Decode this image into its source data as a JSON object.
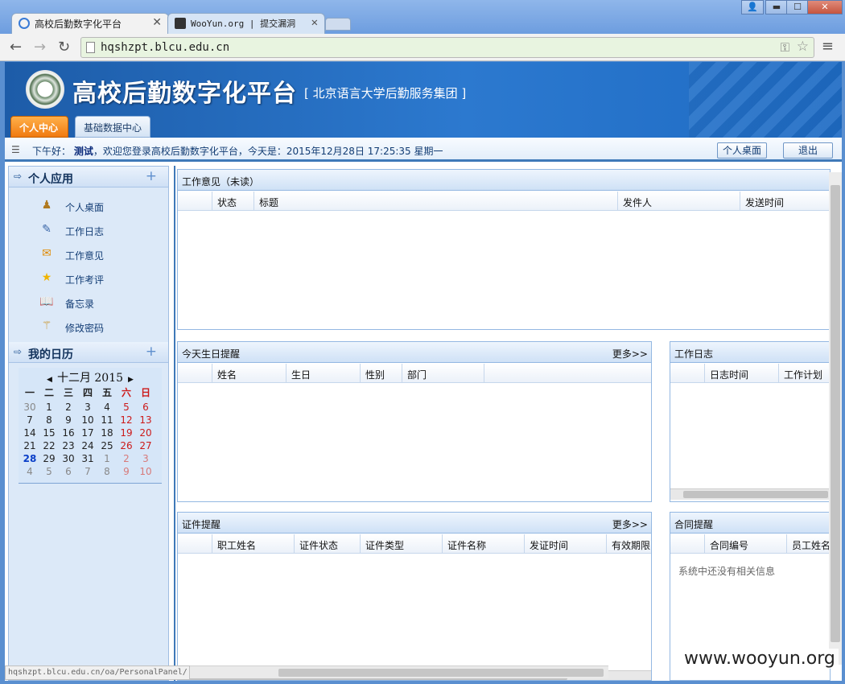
{
  "browser": {
    "tabs": [
      {
        "title": "高校后勤数字化平台",
        "close": "✕"
      },
      {
        "title": "WooYun.org | 提交漏洞",
        "close": "✕"
      }
    ],
    "url": "hqshzpt.blcu.edu.cn",
    "status_text": "hqshzpt.blcu.edu.cn/oa/PersonalPanel/",
    "window_buttons": {
      "user": "👤",
      "minimize": "▬",
      "maximize": "☐",
      "close": "✕"
    }
  },
  "header": {
    "title": "高校后勤数字化平台",
    "subtitle": "[ 北京语言大学后勤服务集团 ]",
    "tabs": {
      "personal": "个人中心",
      "basedata": "基础数据中心"
    }
  },
  "infobar": {
    "greeting_prefix": "下午好：",
    "user": "测试",
    "greeting_rest": "，欢迎您登录高校后勤数字化平台，今天是：2015年12月28日 17:25:35 星期一",
    "desktop_button": "个人桌面",
    "logout_button": "退出"
  },
  "sidebar": {
    "apps_title": "个人应用",
    "items": [
      {
        "label": "个人桌面",
        "icon": "person-icon"
      },
      {
        "label": "工作日志",
        "icon": "notepad-icon"
      },
      {
        "label": "工作意见",
        "icon": "envelope-icon"
      },
      {
        "label": "工作考评",
        "icon": "star-icon"
      },
      {
        "label": "备忘录",
        "icon": "book-icon"
      },
      {
        "label": "修改密码",
        "icon": "wand-icon"
      }
    ],
    "calendar_title": "我的日历",
    "calendar": {
      "month_label": "十二月 2015",
      "weekdays": [
        "一",
        "二",
        "三",
        "四",
        "五",
        "六",
        "日"
      ],
      "rows": [
        [
          "30",
          "1",
          "2",
          "3",
          "4",
          "5",
          "6"
        ],
        [
          "7",
          "8",
          "9",
          "10",
          "11",
          "12",
          "13"
        ],
        [
          "14",
          "15",
          "16",
          "17",
          "18",
          "19",
          "20"
        ],
        [
          "21",
          "22",
          "23",
          "24",
          "25",
          "26",
          "27"
        ],
        [
          "28",
          "29",
          "30",
          "31",
          "1",
          "2",
          "3"
        ],
        [
          "4",
          "5",
          "6",
          "7",
          "8",
          "9",
          "10"
        ]
      ]
    }
  },
  "panels": {
    "feedback": {
      "title": "工作意见（未读）",
      "columns": [
        "状态",
        "标题",
        "发件人",
        "发送时间"
      ]
    },
    "birthday": {
      "title": "今天生日提醒",
      "more": "更多>>",
      "columns": [
        "姓名",
        "生日",
        "性别",
        "部门"
      ]
    },
    "worklog": {
      "title": "工作日志",
      "columns": [
        "日志时间",
        "工作计划"
      ]
    },
    "cert": {
      "title": "证件提醒",
      "more": "更多>>",
      "columns": [
        "职工姓名",
        "证件状态",
        "证件类型",
        "证件名称",
        "发证时间",
        "有效期限"
      ]
    },
    "contract": {
      "title": "合同提醒",
      "columns": [
        "合同编号",
        "员工姓名"
      ],
      "empty": "系统中还没有相关信息"
    }
  },
  "watermark": "www.wooyun.org"
}
